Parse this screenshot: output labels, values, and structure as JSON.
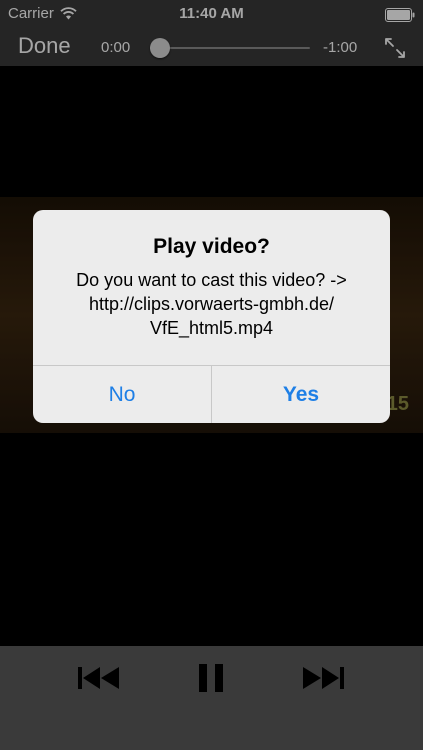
{
  "status_bar": {
    "carrier": "Carrier",
    "time": "11:40 AM"
  },
  "player": {
    "done_label": "Done",
    "elapsed": "0:00",
    "remaining": "-1:00",
    "progress": 0.0
  },
  "video": {
    "overlay_timer": "15"
  },
  "alert": {
    "title": "Play video?",
    "message_lines": [
      "Do you want to cast this video? ->",
      "http://clips.vorwaerts-gmbh.de/",
      "VfE_html5.mp4"
    ],
    "buttons": {
      "no": "No",
      "yes": "Yes"
    },
    "button_color": "#1e7fe6"
  },
  "icons": {
    "wifi": "wifi-icon",
    "battery": "battery-icon",
    "fullscreen": "fullscreen-icon",
    "previous": "skip-back-icon",
    "pause": "pause-icon",
    "next": "skip-forward-icon"
  }
}
